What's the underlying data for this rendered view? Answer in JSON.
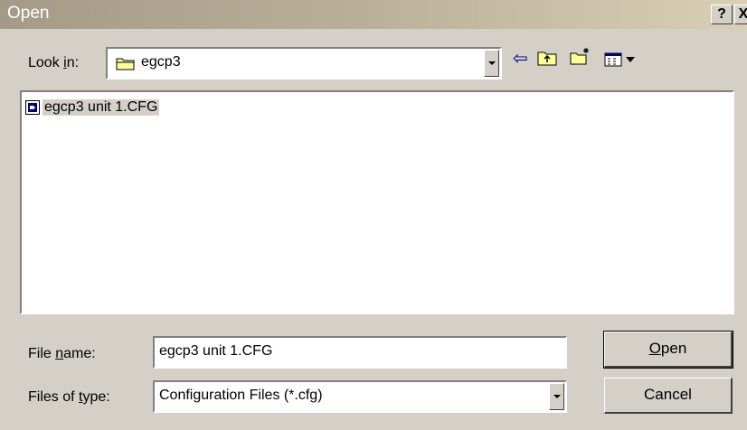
{
  "window": {
    "title": "Open"
  },
  "title_buttons": {
    "help_label": "?",
    "close_label": "X"
  },
  "look_in": {
    "label_pre": "Look ",
    "label_accel": "i",
    "label_post": "n:",
    "value": "egcp3",
    "icon": "folder-icon"
  },
  "toolbar": {
    "back_icon": "back-arrow-icon",
    "up_icon": "up-folder-icon",
    "new_folder_icon": "new-folder-icon",
    "view_menu_icon": "view-menu-icon",
    "back_glyph": "⇦"
  },
  "files": [
    {
      "name": "egcp3 unit 1.CFG",
      "icon": "cfg-file-icon",
      "selected": true
    }
  ],
  "file_name": {
    "label_pre": "File ",
    "label_accel": "n",
    "label_post": "ame:",
    "value": "egcp3 unit 1.CFG"
  },
  "file_type": {
    "label_pre": "Files of ",
    "label_accel": "t",
    "label_post": "ype:",
    "value": "Configuration Files (*.cfg)"
  },
  "buttons": {
    "open_accel": "O",
    "open_rest": "pen",
    "cancel": "Cancel"
  },
  "colors": {
    "title_start": "#a49a87",
    "title_end": "#d8cfb4",
    "face": "#d4d0c8",
    "selection": "#d4d0c8",
    "icon_blue": "#000080",
    "folder_yellow": "#ffff99"
  }
}
